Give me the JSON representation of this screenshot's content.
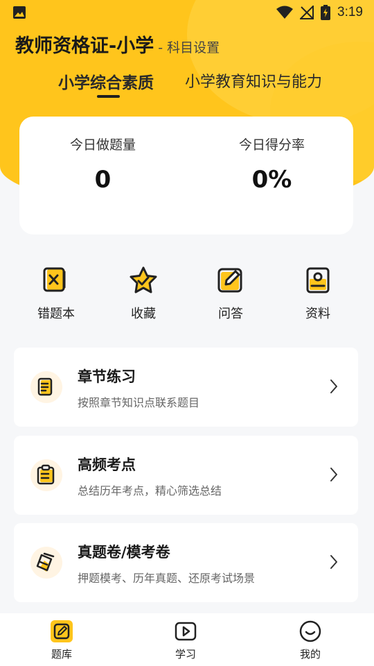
{
  "status_bar": {
    "time": "3:19",
    "icons": [
      "image-icon",
      "wifi-icon",
      "no-signal-icon",
      "battery-charging-icon"
    ]
  },
  "header": {
    "title": "教师资格证-小学",
    "subtitle": "- 科目设置"
  },
  "tabs": [
    {
      "label": "小学综合素质",
      "active": true
    },
    {
      "label": "小学教育知识与能力",
      "active": false
    }
  ],
  "stats": {
    "today_count_label": "今日做题量",
    "today_count_value": "0",
    "score_rate_label": "今日得分率",
    "score_rate_value": "0%"
  },
  "quick_actions": [
    {
      "label": "错题本",
      "icon": "wrong-book-icon"
    },
    {
      "label": "收藏",
      "icon": "star-icon"
    },
    {
      "label": "问答",
      "icon": "edit-icon"
    },
    {
      "label": "资料",
      "icon": "document-icon"
    }
  ],
  "cards": [
    {
      "title": "章节练习",
      "desc": "按照章节知识点联系题目",
      "icon": "notes-icon"
    },
    {
      "title": "高频考点",
      "desc": "总结历年考点，精心筛选总结",
      "icon": "clipboard-icon"
    },
    {
      "title": "真题卷/模考卷",
      "desc": "押题模考、历年真题、还原考试场景",
      "icon": "exam-paper-icon"
    }
  ],
  "bottom_nav": [
    {
      "label": "题库",
      "icon": "question-bank-icon",
      "active": true
    },
    {
      "label": "学习",
      "icon": "play-icon",
      "active": false
    },
    {
      "label": "我的",
      "icon": "smile-icon",
      "active": false
    }
  ],
  "colors": {
    "accent": "#ffc51c",
    "background": "#f6f7f9",
    "card": "#ffffff",
    "icon_bg": "#fff4e3"
  }
}
